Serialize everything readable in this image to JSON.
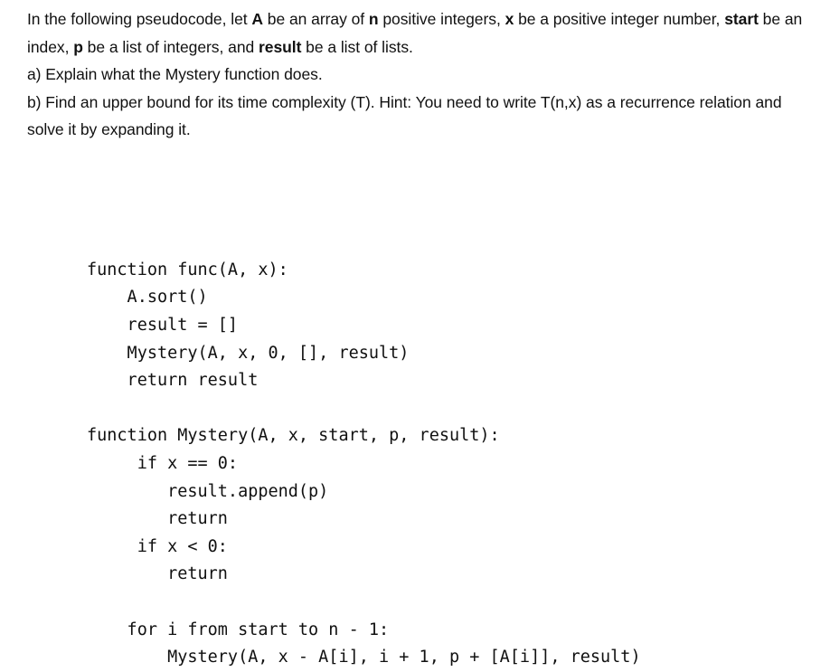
{
  "document": {
    "background_color": "#ffffff",
    "text_color": "#111111"
  },
  "prose": {
    "paragraph_1": {
      "segments": [
        {
          "text": " In the following pseudocode, let ",
          "bold": false
        },
        {
          "text": "A",
          "bold": true
        },
        {
          "text": " be an array of ",
          "bold": false
        },
        {
          "text": "n",
          "bold": true
        },
        {
          "text": " positive integers, ",
          "bold": false
        },
        {
          "text": "x",
          "bold": true
        },
        {
          "text": " be a positive integer number, ",
          "bold": false
        },
        {
          "text": "start",
          "bold": true
        },
        {
          "text": " be an index, ",
          "bold": false
        },
        {
          "text": "p",
          "bold": true
        },
        {
          "text": " be a list of integers, and ",
          "bold": false
        },
        {
          "text": "result",
          "bold": true
        },
        {
          "text": " be a list of lists.",
          "bold": false
        }
      ],
      "plain_text": " In the following pseudocode, let A be an array of n positive integers, x be a positive integer number, start be an index, p be a list of integers, and result be a list of lists."
    },
    "question_a": "a) Explain what the Mystery function does.",
    "question_b": "b) Find an upper bound for its time complexity (T). Hint: You need to write T(n,x) as a recurrence relation and solve it by expanding it."
  },
  "pseudocode": {
    "lines": [
      "function func(A, x):",
      "    A.sort()",
      "    result = []",
      "    Mystery(A, x, 0, [], result)",
      "    return result",
      "",
      "function Mystery(A, x, start, p, result):",
      "     if x == 0:",
      "        result.append(p)",
      "        return",
      "     if x < 0:",
      "        return",
      "",
      "    for i from start to n - 1:",
      "        Mystery(A, x - A[i], i + 1, p + [A[i]], result)"
    ]
  }
}
